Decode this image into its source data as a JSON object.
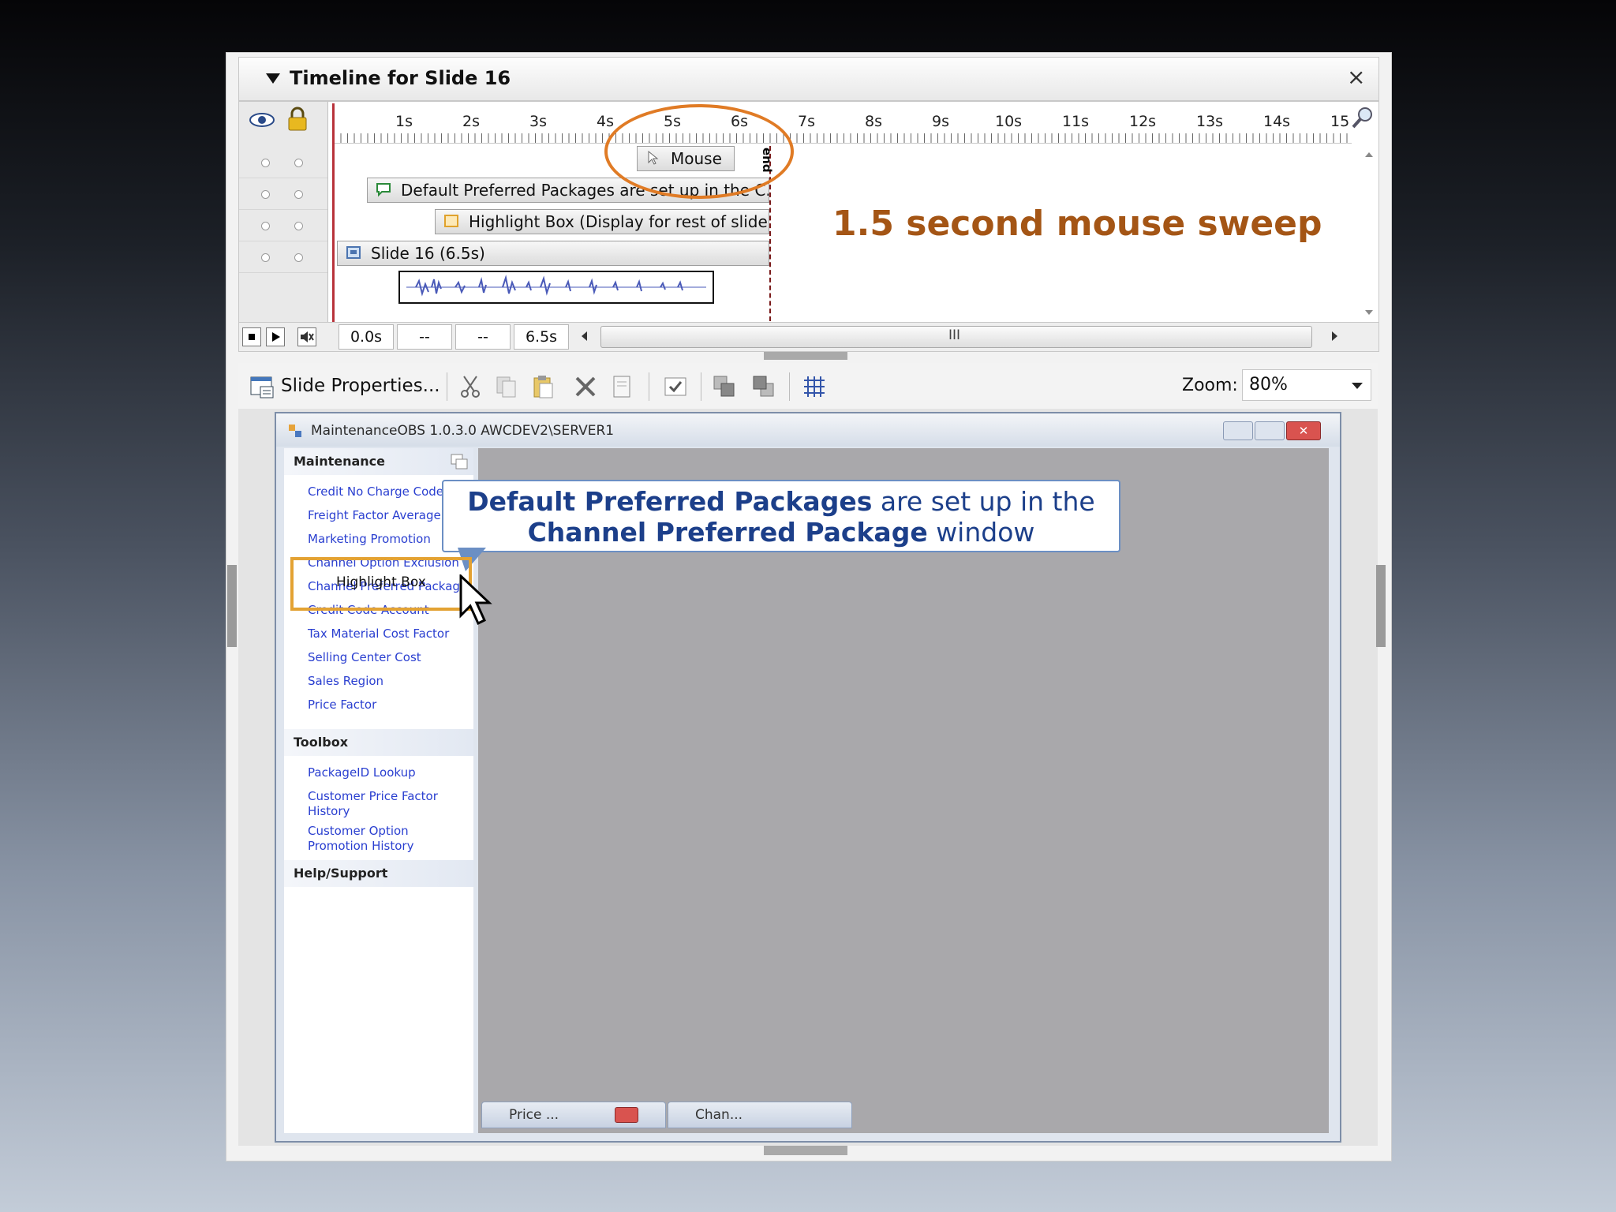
{
  "timeline": {
    "title": "Timeline for Slide 16",
    "close_label": "×",
    "ruler_ticks": [
      "1s",
      "2s",
      "3s",
      "4s",
      "5s",
      "6s",
      "7s",
      "8s",
      "9s",
      "10s",
      "11s",
      "12s",
      "13s",
      "14s",
      "15"
    ],
    "end_label": "end",
    "items": [
      {
        "label": "Mouse"
      },
      {
        "label": "Default Preferred Packages are set up in the C..."
      },
      {
        "label": "Highlight Box (Display for rest of slide)"
      },
      {
        "label": "Slide 16 (6.5s)"
      }
    ],
    "controls": {
      "start_time": "0.0s",
      "field2": "--",
      "field3": "--",
      "duration": "6.5s",
      "scroll_grip": "III"
    }
  },
  "toolbar": {
    "slide_properties_label": "Slide Properties...",
    "zoom_label": "Zoom:",
    "zoom_value": "80%"
  },
  "app_window": {
    "title": "MaintenanceOBS 1.0.3.0 AWCDEV2\\SERVER1",
    "sections": [
      {
        "title": "Maintenance",
        "items": [
          "Credit No Charge Code",
          "Freight Factor Average",
          "Marketing Promotion",
          "Channel Option Exclusion",
          "Channel Preferred Package",
          "Credit Code Account",
          "Tax Material Cost Factor",
          "Selling Center Cost",
          "Sales Region",
          "Price Factor"
        ]
      },
      {
        "title": "Toolbox",
        "items": [
          "PackageID Lookup",
          "Customer Price Factor History",
          "Customer Option Promotion History"
        ]
      },
      {
        "title": "Help/Support",
        "items": []
      }
    ],
    "minimized_tabs": [
      "Price ...",
      "Chan..."
    ]
  },
  "callout": {
    "bold1": "Default Preferred Packages",
    "text1": " are set up in the",
    "bold2": "Channel Preferred Package",
    "text2": " window"
  },
  "highlight_box_label": "Highlight Box",
  "annotation": "1.5 second mouse sweep",
  "colors": {
    "annotation": "#a45515",
    "ellipse": "#e07b25",
    "highlight": "#e3a233",
    "callout_text": "#1c3f8a",
    "link": "#2a3fd0"
  }
}
